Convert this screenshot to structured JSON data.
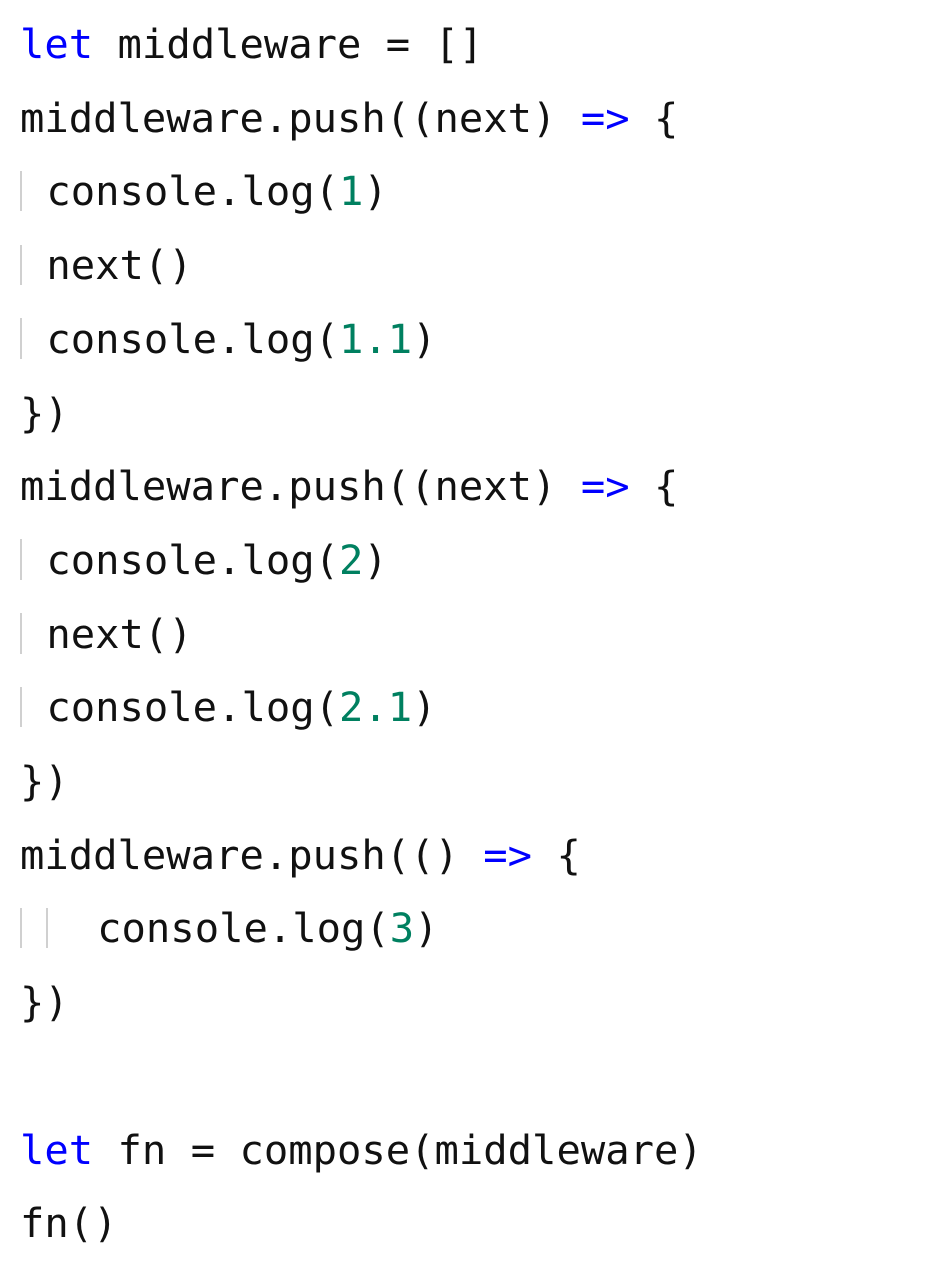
{
  "code": {
    "tokens": [
      [
        {
          "t": "let ",
          "c": "keyword"
        },
        {
          "t": "middleware = []",
          "c": "default"
        }
      ],
      [
        {
          "t": "middleware.push((next) ",
          "c": "default"
        },
        {
          "t": "=>",
          "c": "arrow"
        },
        {
          "t": " {",
          "c": "default"
        }
      ],
      [
        {
          "t": "GUIDE",
          "c": "guide"
        },
        {
          "t": " console.log(",
          "c": "default"
        },
        {
          "t": "1",
          "c": "number"
        },
        {
          "t": ")",
          "c": "default"
        }
      ],
      [
        {
          "t": "GUIDE",
          "c": "guide"
        },
        {
          "t": " next()",
          "c": "default"
        }
      ],
      [
        {
          "t": "GUIDE",
          "c": "guide"
        },
        {
          "t": " console.log(",
          "c": "default"
        },
        {
          "t": "1.1",
          "c": "number"
        },
        {
          "t": ")",
          "c": "default"
        }
      ],
      [
        {
          "t": "})",
          "c": "default"
        }
      ],
      [
        {
          "t": "middleware.push((next) ",
          "c": "default"
        },
        {
          "t": "=>",
          "c": "arrow"
        },
        {
          "t": " {",
          "c": "default"
        }
      ],
      [
        {
          "t": "GUIDE",
          "c": "guide"
        },
        {
          "t": " console.log(",
          "c": "default"
        },
        {
          "t": "2",
          "c": "number"
        },
        {
          "t": ")",
          "c": "default"
        }
      ],
      [
        {
          "t": "GUIDE",
          "c": "guide"
        },
        {
          "t": " next()",
          "c": "default"
        }
      ],
      [
        {
          "t": "GUIDE",
          "c": "guide"
        },
        {
          "t": " console.log(",
          "c": "default"
        },
        {
          "t": "2.1",
          "c": "number"
        },
        {
          "t": ")",
          "c": "default"
        }
      ],
      [
        {
          "t": "})",
          "c": "default"
        }
      ],
      [
        {
          "t": "middleware.push(() ",
          "c": "default"
        },
        {
          "t": "=>",
          "c": "arrow"
        },
        {
          "t": " {",
          "c": "default"
        }
      ],
      [
        {
          "t": "GUIDE",
          "c": "guide"
        },
        {
          "t": " ",
          "c": "default"
        },
        {
          "t": "GUIDE",
          "c": "guide"
        },
        {
          "t": "  console.log(",
          "c": "default"
        },
        {
          "t": "3",
          "c": "number"
        },
        {
          "t": ")",
          "c": "default"
        }
      ],
      [
        {
          "t": "})",
          "c": "default"
        }
      ],
      [
        {
          "t": "",
          "c": "default"
        }
      ],
      [
        {
          "t": "let ",
          "c": "keyword"
        },
        {
          "t": "fn = compose(middleware)",
          "c": "default"
        }
      ],
      [
        {
          "t": "fn()",
          "c": "default"
        }
      ]
    ]
  }
}
